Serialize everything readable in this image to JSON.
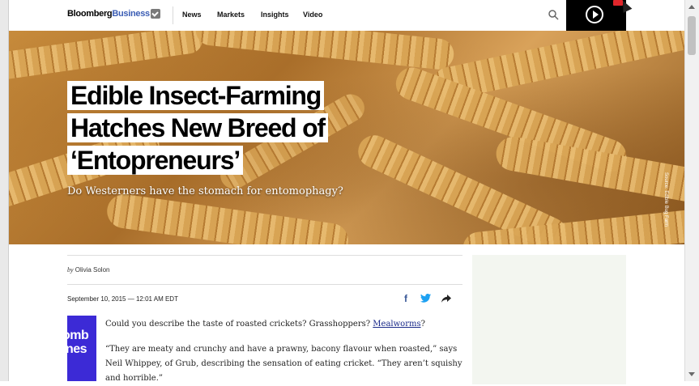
{
  "brand": {
    "part1": "Bloomberg",
    "part2": "Business"
  },
  "nav": {
    "links": [
      "News",
      "Markets",
      "Insights",
      "Video"
    ]
  },
  "hero": {
    "headline_lines": [
      "Edible Insect-Farming",
      "Hatches New Breed of",
      "‘Entopreneurs’"
    ],
    "dek": "Do Westerners have the stomach for entomophagy?",
    "credit": "Source: Edible Bug Farm"
  },
  "article": {
    "byline_prefix": "by",
    "author": "Olivia Solon",
    "date": "September 10, 2015 — 12:01 AM EDT",
    "p1_before": "Could you describe the taste of roasted crickets? Grasshoppers?",
    "p1_link": "Mealworms",
    "p1_after": "?",
    "p2_lines": [
      "“They are meaty and crunchy and have a prawny, bacony flavour when roasted,” says",
      "Neil Whippey, of Grub, describing the sensation of eating cricket. “They aren’t squishy",
      "and horrible.”"
    ]
  },
  "tile": {
    "lines": [
      "omb",
      "ines"
    ]
  },
  "icons": {
    "search": "search-icon",
    "play": "play-icon",
    "facebook": "facebook-icon",
    "twitter": "twitter-icon",
    "share": "share-arrow-icon"
  },
  "colors": {
    "tile": "#3c2ad6",
    "facebook": "#3b5998",
    "twitter": "#1da1f2",
    "live": "#e0262b"
  }
}
